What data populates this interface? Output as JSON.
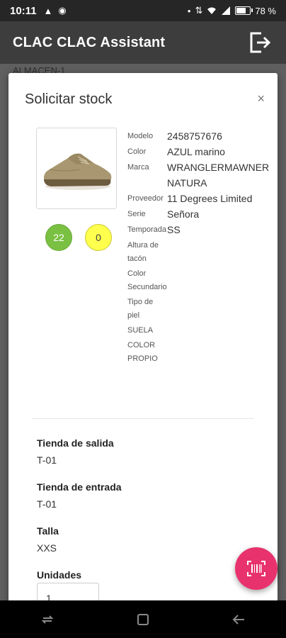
{
  "status_bar": {
    "time": "10:11",
    "battery": "78 %",
    "battery_level": 0.78
  },
  "app_bar": {
    "title": "CLAC CLAC Assistant"
  },
  "background": {
    "text": "ALMACEN-1"
  },
  "modal": {
    "title": "Solicitar stock",
    "close": "×",
    "stock": {
      "green": "22",
      "yellow": "0"
    },
    "attributes": [
      {
        "label": "Modelo",
        "value": "2458757676"
      },
      {
        "label": "Color",
        "value": "AZUL marino"
      },
      {
        "label": "Marca",
        "value": "WRANGLERMAWNER NATURA"
      },
      {
        "label": "Proveedor",
        "value": "11 Degrees Limited"
      },
      {
        "label": "Serie",
        "value": "Señora"
      },
      {
        "label": "Temporada",
        "value": "SS"
      },
      {
        "label": "Altura de tacón",
        "value": ""
      },
      {
        "label": "Color Secundario",
        "value": ""
      },
      {
        "label": "Tipo de piel",
        "value": ""
      },
      {
        "label": "SUELA",
        "value": ""
      },
      {
        "label": "COLOR PROPIO",
        "value": ""
      }
    ],
    "fields": {
      "tienda_salida": {
        "label": "Tienda de salida",
        "value": "T-01"
      },
      "tienda_entrada": {
        "label": "Tienda de entrada",
        "value": "T-01"
      },
      "talla": {
        "label": "Talla",
        "value": "XXS"
      },
      "unidades": {
        "label": "Unidades",
        "value": "1"
      }
    }
  },
  "colors": {
    "fab": "#e8326e",
    "green": "#7ac143",
    "yellow": "#ffff4d",
    "app_bar": "#3d3d3d"
  }
}
